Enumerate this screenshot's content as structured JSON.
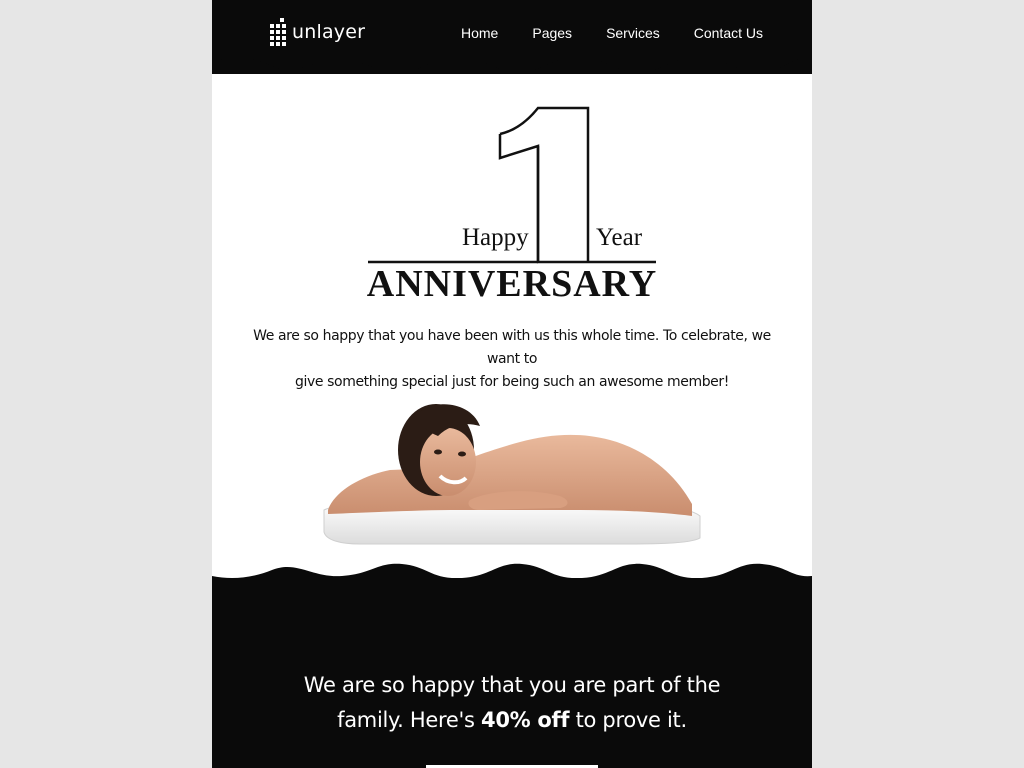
{
  "header": {
    "logo_text": "unlayer",
    "nav": [
      "Home",
      "Pages",
      "Services",
      "Contact Us"
    ]
  },
  "hero": {
    "big_number": "1",
    "happy": "Happy",
    "year": "Year",
    "title": "ANNIVERSARY",
    "intro_line1": "We are so happy that you have been with us this whole time. To celebrate, we want to",
    "intro_line2": "give something special just for being such an awesome member!"
  },
  "promo": {
    "line1": "We are so happy that you are part of the",
    "line2_before": "family. Here's ",
    "line2_bold": "40% off",
    "line2_after": " to prove it."
  },
  "colors": {
    "page_bg": "#e6e6e6",
    "dark": "#0a0a0a",
    "light": "#ffffff"
  }
}
